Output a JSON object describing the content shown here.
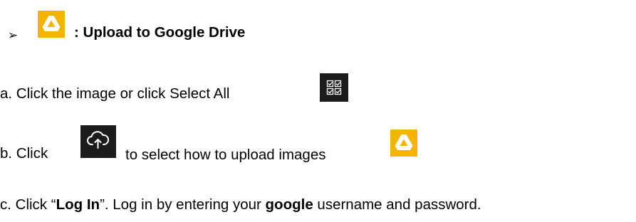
{
  "section": {
    "bullet": "➢",
    "heading": ": Upload to Google Drive",
    "drive_icon": "google-drive-icon"
  },
  "steps": {
    "a": {
      "text": "a. Click the image or click Select All",
      "icon": "select-all-icon"
    },
    "b": {
      "text_before": "b. Click",
      "text_after": "to select how to upload images",
      "icon": "cloud-upload-icon",
      "trailing_icon": "google-drive-icon"
    },
    "c": {
      "prefix": "c. Click “",
      "login": "Log In",
      "middle": "”. Log in by entering your ",
      "google": "google",
      "suffix": " username and password."
    }
  },
  "colors": {
    "drive_yellow": "#f4b400",
    "dark_icon_bg": "#1c1c1c"
  }
}
